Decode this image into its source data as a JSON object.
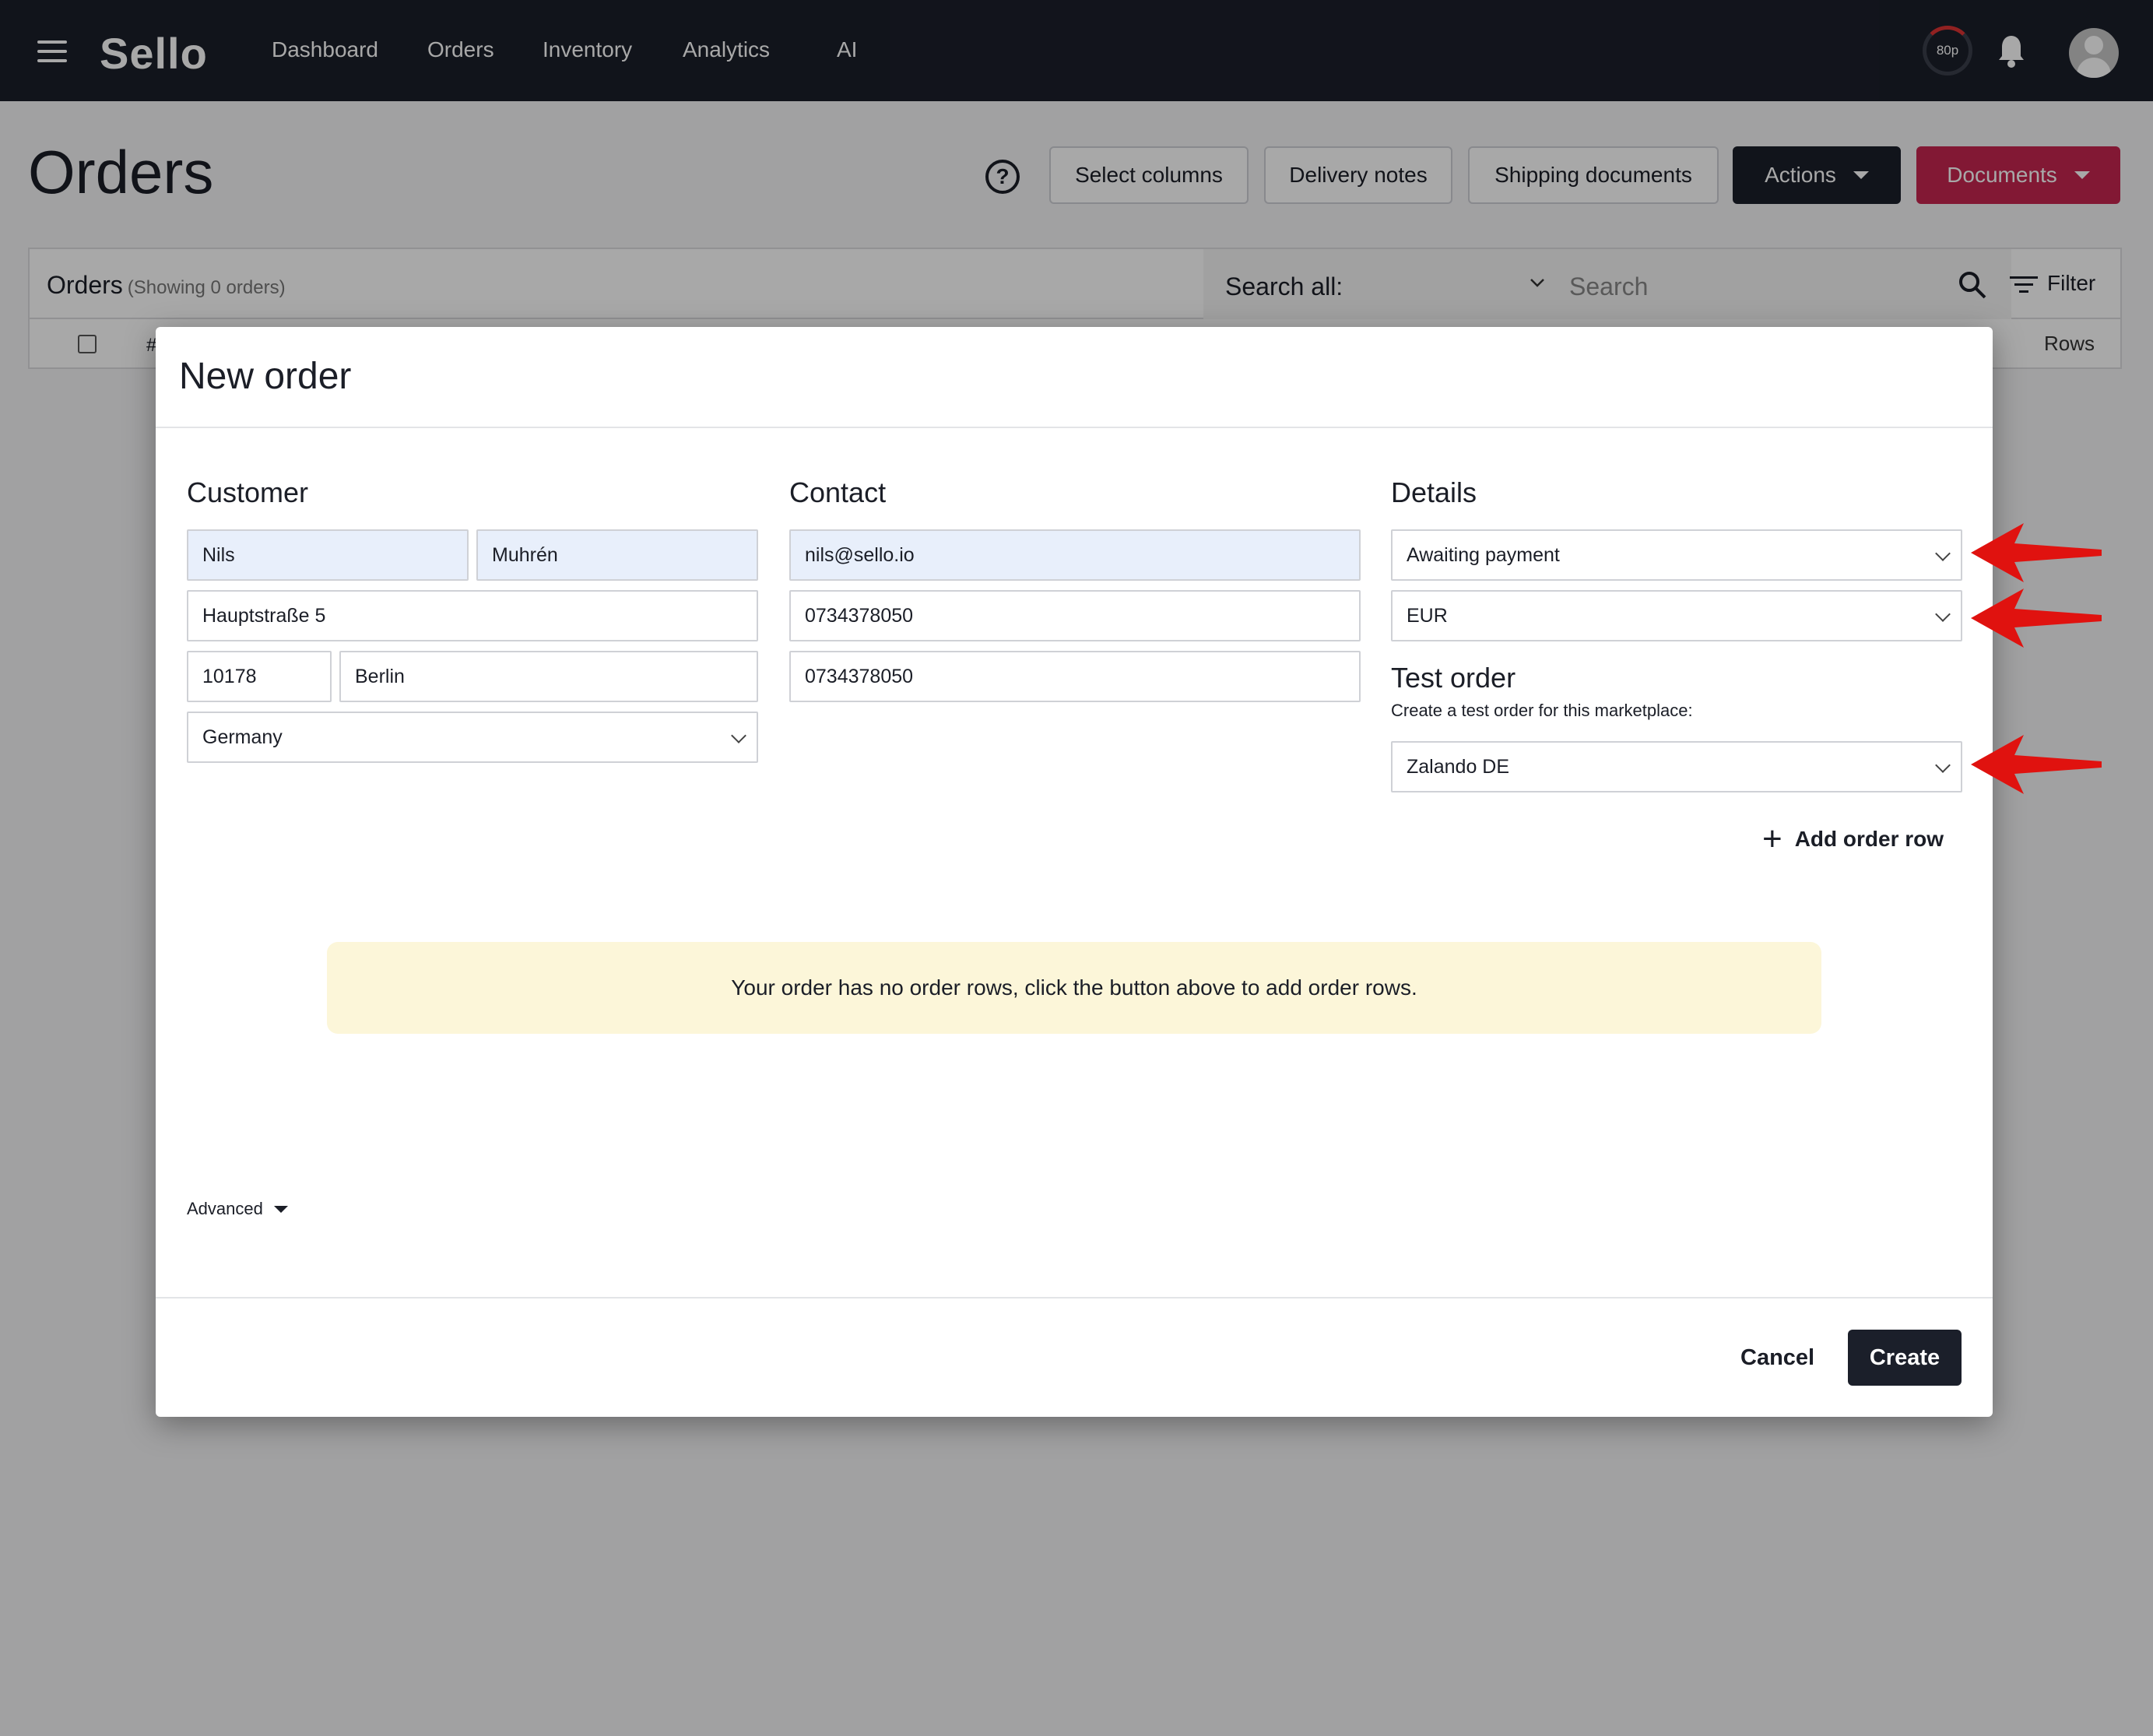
{
  "topbar": {
    "logo": "Sello",
    "nav": [
      "Dashboard",
      "Orders",
      "Inventory",
      "Analytics",
      "AI"
    ],
    "quota": "80p"
  },
  "page": {
    "title": "Orders",
    "buttons": {
      "select_columns": "Select columns",
      "delivery_notes": "Delivery notes",
      "shipping_documents": "Shipping documents",
      "actions": "Actions",
      "documents": "Documents"
    },
    "panel": {
      "label": "Orders",
      "count": "(Showing 0 orders)",
      "search_all_label": "Search all:",
      "search_placeholder": "Search",
      "filter": "Filter",
      "hash_column": "#",
      "rows_column": "Rows"
    }
  },
  "modal": {
    "title": "New order",
    "customer": {
      "title": "Customer",
      "first_name": "Nils",
      "last_name": "Muhrén",
      "street": "Hauptstraße 5",
      "zip": "10178",
      "city": "Berlin",
      "country": "Germany"
    },
    "contact": {
      "title": "Contact",
      "email": "nils@sello.io",
      "phone": "0734378050",
      "mobile": "0734378050"
    },
    "details": {
      "title": "Details",
      "status": "Awaiting payment",
      "currency": "EUR"
    },
    "test_order": {
      "title": "Test order",
      "subtitle": "Create a test order for this marketplace:",
      "marketplace": "Zalando DE"
    },
    "add_order_row": "Add order row",
    "notice": "Your order has no order rows, click the button above to add order rows.",
    "advanced": "Advanced",
    "cancel": "Cancel",
    "create": "Create"
  },
  "colors": {
    "topbar": "#1b1f2a",
    "documents_button": "#c5254f",
    "notice_bg": "#fcf6d9",
    "filled_field": "#e8effb",
    "annotation_arrow": "#e0120f"
  }
}
